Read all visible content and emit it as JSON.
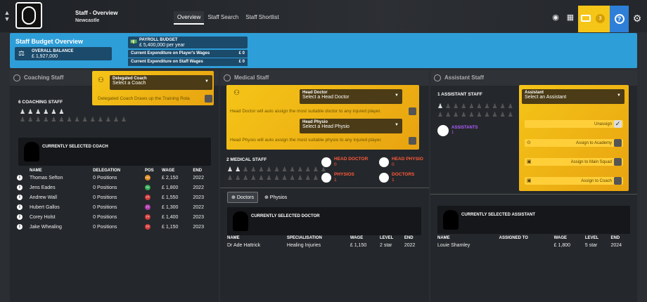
{
  "header": {
    "title": "Staff - Overview",
    "subtitle": "Newcastle",
    "tabs": [
      "Overview",
      "Staff Search",
      "Staff Shortlist"
    ],
    "notification_count": "3"
  },
  "budget": {
    "title": "Staff Budget Overview",
    "overall_balance_label": "OVERALL BALANCE",
    "overall_balance_value": "£ 1,927,000",
    "payroll_label": "PAYROLL BUDGET",
    "payroll_value": "£ 5,400,000 per year",
    "exp_players_label": "Current Expenditure on Player's Wages",
    "exp_players_value": "£ 0",
    "exp_staff_label": "Current Expenditure on Staff Wages",
    "exp_staff_value": "£ 0"
  },
  "coaching": {
    "title": "Coaching Staff",
    "delegated_label": "Delegated Coach",
    "delegated_placeholder": "Select a Coach",
    "delegated_note": "Delegated Coach Draws up the Training Rota",
    "count": "6 COACHING STAFF",
    "selected_title": "CURRENTLY SELECTED COACH",
    "columns": [
      "NAME",
      "DELEGATION",
      "POS",
      "WAGE",
      "END"
    ],
    "rows": [
      {
        "name": "Thomas Sefton",
        "delegation": "0 Positions",
        "pos": "HD",
        "wage": "£ 2,150",
        "end": "2022"
      },
      {
        "name": "Jens Eades",
        "delegation": "0 Positions",
        "pos": "SK",
        "wage": "£ 1,800",
        "end": "2022"
      },
      {
        "name": "Andrew Wall",
        "delegation": "0 Positions",
        "pos": "TP",
        "wage": "£ 1,550",
        "end": "2023"
      },
      {
        "name": "Hubert Gallos",
        "delegation": "0 Positions",
        "pos": "FI",
        "wage": "£ 1,300",
        "end": "2022"
      },
      {
        "name": "Corey Holst",
        "delegation": "0 Positions",
        "pos": "TP",
        "wage": "£ 1,400",
        "end": "2023"
      },
      {
        "name": "Jake Whealing",
        "delegation": "0 Positions",
        "pos": "TP",
        "wage": "£ 1,150",
        "end": "2023"
      }
    ]
  },
  "medical": {
    "title": "Medical Staff",
    "doctor_label": "Head Doctor",
    "doctor_placeholder": "Select a Head Doctor",
    "doctor_note": "Head Doctor will auto assign the most suitable doctor to any injured player.",
    "physio_label": "Head Physio",
    "physio_placeholder": "Select a Head Physio",
    "physio_note": "Head Physio will auto assign the most suitable physio to any injured player.",
    "count": "2 MEDICAL STAFF",
    "stats": [
      {
        "label": "HEAD DOCTOR",
        "value": "0"
      },
      {
        "label": "HEAD PHYSIO",
        "value": "0"
      },
      {
        "label": "PHYSIOS",
        "value": "1"
      },
      {
        "label": "DOCTORS",
        "value": "1"
      }
    ],
    "tab_doctors": "Doctors",
    "tab_physios": "Physios",
    "selected_title": "CURRENTLY SELECTED DOCTOR",
    "columns": [
      "NAME",
      "SPECIALISATION",
      "WAGE",
      "LEVEL",
      "END"
    ],
    "rows": [
      {
        "name": "Dr Ade Hattrick",
        "spec": "Healing Injuries",
        "wage": "£ 1,150",
        "level": "2 star",
        "end": "2022"
      }
    ]
  },
  "assistant": {
    "title": "Assistant Staff",
    "count": "1 ASSISTANT STAFF",
    "assistant_label": "Assistant",
    "assistant_placeholder": "Select an Assistant",
    "assistants_label": "ASSISTANTS",
    "assistants_value": "1",
    "options": [
      "Unassign",
      "Assign to Academy",
      "Assign to Main Squad",
      "Assign to Coach"
    ],
    "selected_title": "CURRENTLY SELECTED ASSISTANT",
    "columns": [
      "NAME",
      "ASSIGNED TO",
      "WAGE",
      "LEVEL",
      "END"
    ],
    "rows": [
      {
        "name": "Louie Shamley",
        "assigned": "",
        "wage": "£ 1,800",
        "level": "5 star",
        "end": "2024"
      }
    ]
  },
  "colors": {
    "accent_blue": "#2e9ed8",
    "accent_yellow": "#f5c518",
    "stat_red": "#ff5a3a",
    "stat_purple": "#b05cff"
  }
}
